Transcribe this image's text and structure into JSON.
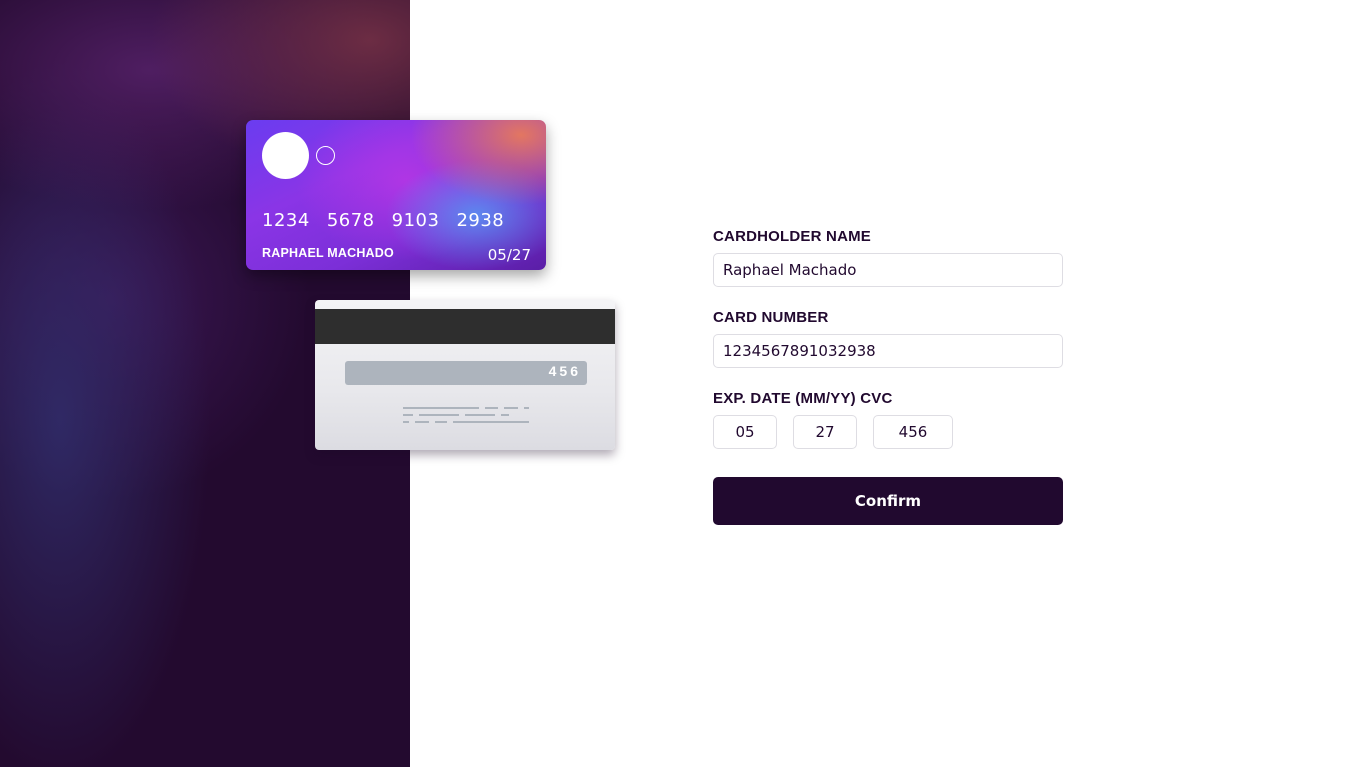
{
  "card_front": {
    "number_groups": [
      "1234",
      "5678",
      "9103",
      "2938"
    ],
    "holder_name": "RAPHAEL MACHADO",
    "expiry": "05/27"
  },
  "card_back": {
    "cvc": "456"
  },
  "form": {
    "cardholder_label": "CARDHOLDER NAME",
    "cardholder_value": "Raphael Machado",
    "number_label": "CARD NUMBER",
    "number_value": "1234567891032938",
    "date_cvc_label": "EXP. DATE (MM/YY) CVC",
    "month_value": "05",
    "year_value": "27",
    "cvc_value": "456",
    "confirm_label": "Confirm"
  },
  "colors": {
    "dark_violet": "#21092f",
    "input_border": "#dedde3",
    "card_back_strip": "#adb4bd"
  }
}
